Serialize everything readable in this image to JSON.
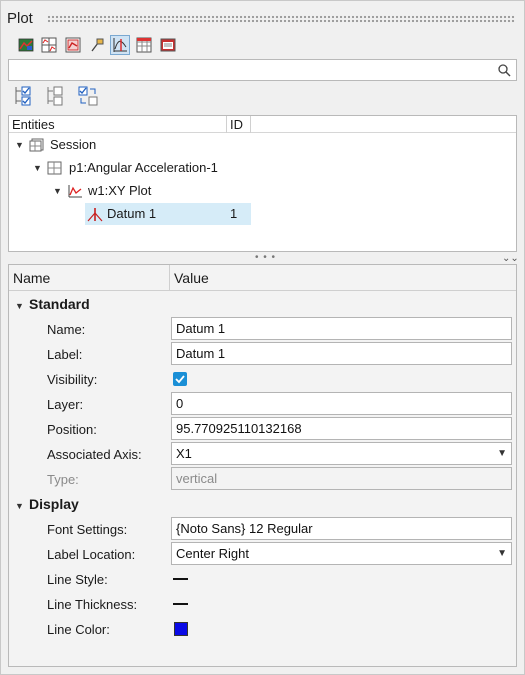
{
  "panel": {
    "title": "Plot"
  },
  "toolbar": {
    "icons": [
      "plot-map-icon",
      "grid-plot-icon",
      "page-plot-icon",
      "datum-pin-icon",
      "xy-plot-icon",
      "table-grid-icon",
      "notes-icon"
    ]
  },
  "search": {
    "value": "",
    "placeholder": ""
  },
  "tree": {
    "columns": {
      "entities": "Entities",
      "id": "ID"
    },
    "rows": [
      {
        "label": "Session",
        "id": ""
      },
      {
        "label": "p1:Angular Acceleration-1",
        "id": ""
      },
      {
        "label": "w1:XY Plot",
        "id": ""
      },
      {
        "label": "Datum 1",
        "id": "1"
      }
    ]
  },
  "props": {
    "header": {
      "name": "Name",
      "value": "Value"
    },
    "standard": {
      "title": "Standard",
      "name_label": "Name:",
      "name_value": "Datum 1",
      "label_label": "Label:",
      "label_value": "Datum 1",
      "visibility_label": "Visibility:",
      "visibility_checked": true,
      "layer_label": "Layer:",
      "layer_value": "0",
      "position_label": "Position:",
      "position_value": "95.770925110132168",
      "axis_label": "Associated Axis:",
      "axis_value": "X1",
      "type_label": "Type:",
      "type_value": "vertical"
    },
    "display": {
      "title": "Display",
      "font_label": "Font Settings:",
      "font_value": "{Noto Sans} 12 Regular",
      "location_label": "Label Location:",
      "location_value": "Center Right",
      "linestyle_label": "Line Style:",
      "thickness_label": "Line Thickness:",
      "color_label": "Line Color:",
      "line_color": "#0a0ae6"
    }
  }
}
